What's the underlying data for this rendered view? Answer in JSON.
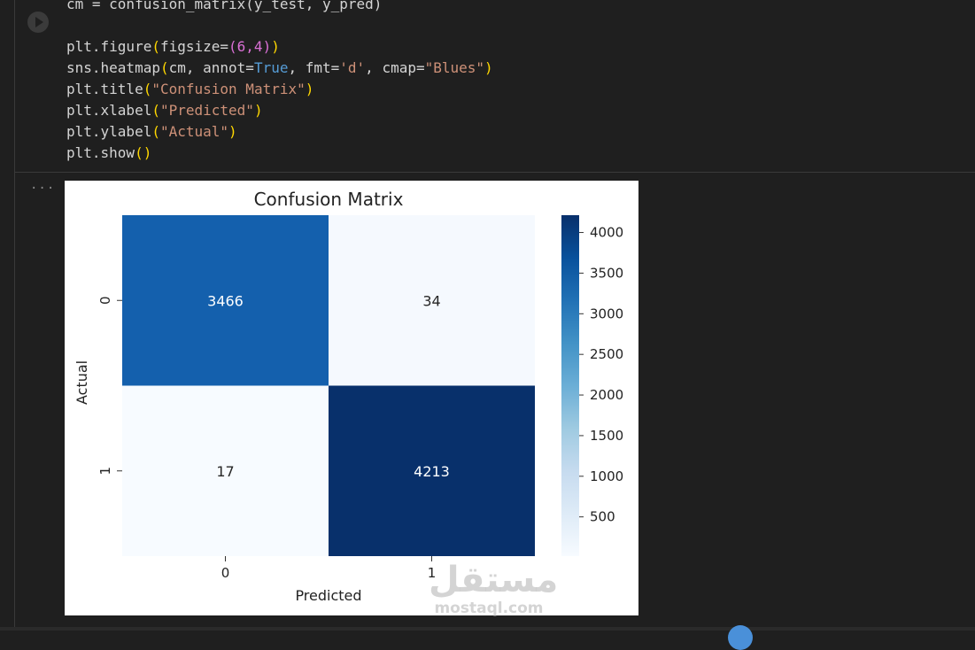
{
  "code": {
    "line1": "cm = confusion_matrix(y_test, y_pred)",
    "line2a": "plt.figure",
    "line2b": "(",
    "line2c": "figsize=",
    "line2d": "(6,4)",
    "line2e": ")",
    "line3a": "sns.heatmap",
    "line3b": "(",
    "line3c": "cm, annot=",
    "line3d": "True",
    "line3e": ", fmt=",
    "line3f": "'d'",
    "line3g": ", cmap=",
    "line3h": "\"Blues\"",
    "line3i": ")",
    "line4a": "plt.title",
    "line4b": "(",
    "line4c": "\"Confusion Matrix\"",
    "line4d": ")",
    "line5a": "plt.xlabel",
    "line5b": "(",
    "line5c": "\"Predicted\"",
    "line5d": ")",
    "line6a": "plt.ylabel",
    "line6b": "(",
    "line6c": "\"Actual\"",
    "line6d": ")",
    "line7a": "plt.show",
    "line7b": "()"
  },
  "output_menu_icon": "ellipsis-icon",
  "watermark": {
    "logo_text": "مستقل",
    "url": "mostaql.com"
  },
  "chart_data": {
    "type": "heatmap",
    "title": "Confusion Matrix",
    "xlabel": "Predicted",
    "ylabel": "Actual",
    "x_categories": [
      "0",
      "1"
    ],
    "y_categories": [
      "0",
      "1"
    ],
    "values": [
      [
        3466,
        34
      ],
      [
        17,
        4213
      ]
    ],
    "colormap": "Blues",
    "colorbar": {
      "min": 17,
      "max": 4213,
      "ticks": [
        500,
        1000,
        1500,
        2000,
        2500,
        3000,
        3500,
        4000
      ]
    },
    "cell_colors": [
      [
        "#1460ad",
        "#f5f9fe"
      ],
      [
        "#f7fbff",
        "#08306b"
      ]
    ]
  }
}
